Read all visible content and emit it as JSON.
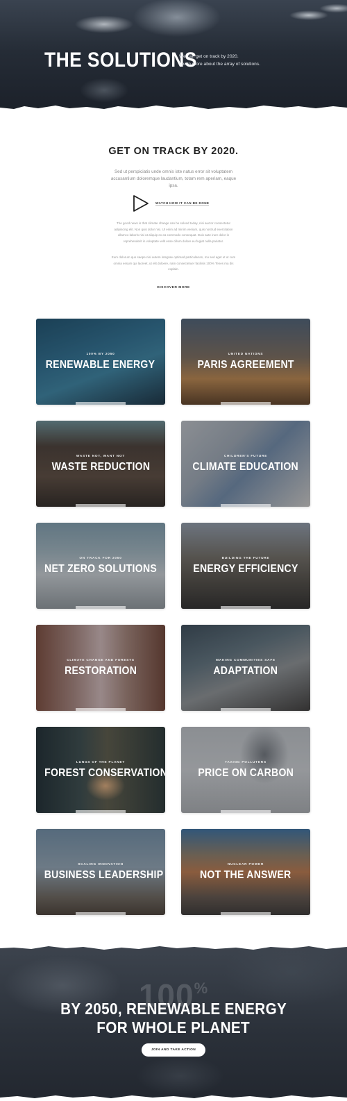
{
  "hero": {
    "title": "THE SOLUTIONS",
    "subtitle_line1": "We can get on track by 2020.",
    "subtitle_line2": "Learn more about the array of solutions."
  },
  "intro": {
    "title": "GET ON TRACK BY 2020.",
    "lead": "Sed ut perspiciatis unde omnis iste natus error sit voluptatem accusantium doloremque laudantium, totam rem aperiam, eaque ipsa.",
    "watch_label": "WATCH HOW IT CAN BE DONE",
    "paragraph1": "The good news is that climate change can be solved today, nisi auctor consectetur adipiscing elit. Non quis dolor nisi. Ut enim ad minim veniam, quis nostrud exercitation ullamco laboris nisi ut aliquip ex ea commodo consequat. Duis aute irure dolor in reprehenderit in voluptate velit esse cillum dolore eu fugiat nulla pariatur.",
    "paragraph2": "Eum dolorum quo saepe nisi autem integrae optimad particularum, mo sed aget ut ut cum omnia essum qui laoreet, ut elit doloere, nam consectetuer facilisis 100% Tenes ma dis explain.",
    "discover_label": "DISCOVER MORE"
  },
  "cards": [
    {
      "kicker": "100% BY 2050",
      "title": "RENEWABLE ENERGY"
    },
    {
      "kicker": "UNITED NATIONS",
      "title": "PARIS AGREEMENT"
    },
    {
      "kicker": "WASTE NOT, WANT NOT",
      "title": "WASTE REDUCTION"
    },
    {
      "kicker": "CHILDREN'S FUTURE",
      "title": "CLIMATE EDUCATION"
    },
    {
      "kicker": "ON TRACK FOR 2050",
      "title": "NET ZERO SOLUTIONS"
    },
    {
      "kicker": "BUILDING THE FUTURE",
      "title": "ENERGY EFFICIENCY"
    },
    {
      "kicker": "CLIMATE CHANGE AND FORESTS",
      "title": "RESTORATION"
    },
    {
      "kicker": "MAKING COMMUNITIES SAFE",
      "title": "ADAPTATION"
    },
    {
      "kicker": "LUNGS OF THE PLANET",
      "title": "FOREST CONSERVATION"
    },
    {
      "kicker": "TAXING POLLUTERS",
      "title": "PRICE ON CARBON"
    },
    {
      "kicker": "SCALING INNOVATION",
      "title": "BUSINESS LEADERSHIP"
    },
    {
      "kicker": "NUCLEAR POWER",
      "title": "NOT THE ANSWER"
    }
  ],
  "footer": {
    "big_number": "100",
    "big_unit": "%",
    "title_line1": "BY 2050, RENEWABLE ENERGY",
    "title_line2": "FOR WHOLE PLANET",
    "cta_label": "JOIN AND TAKE ACTION"
  }
}
